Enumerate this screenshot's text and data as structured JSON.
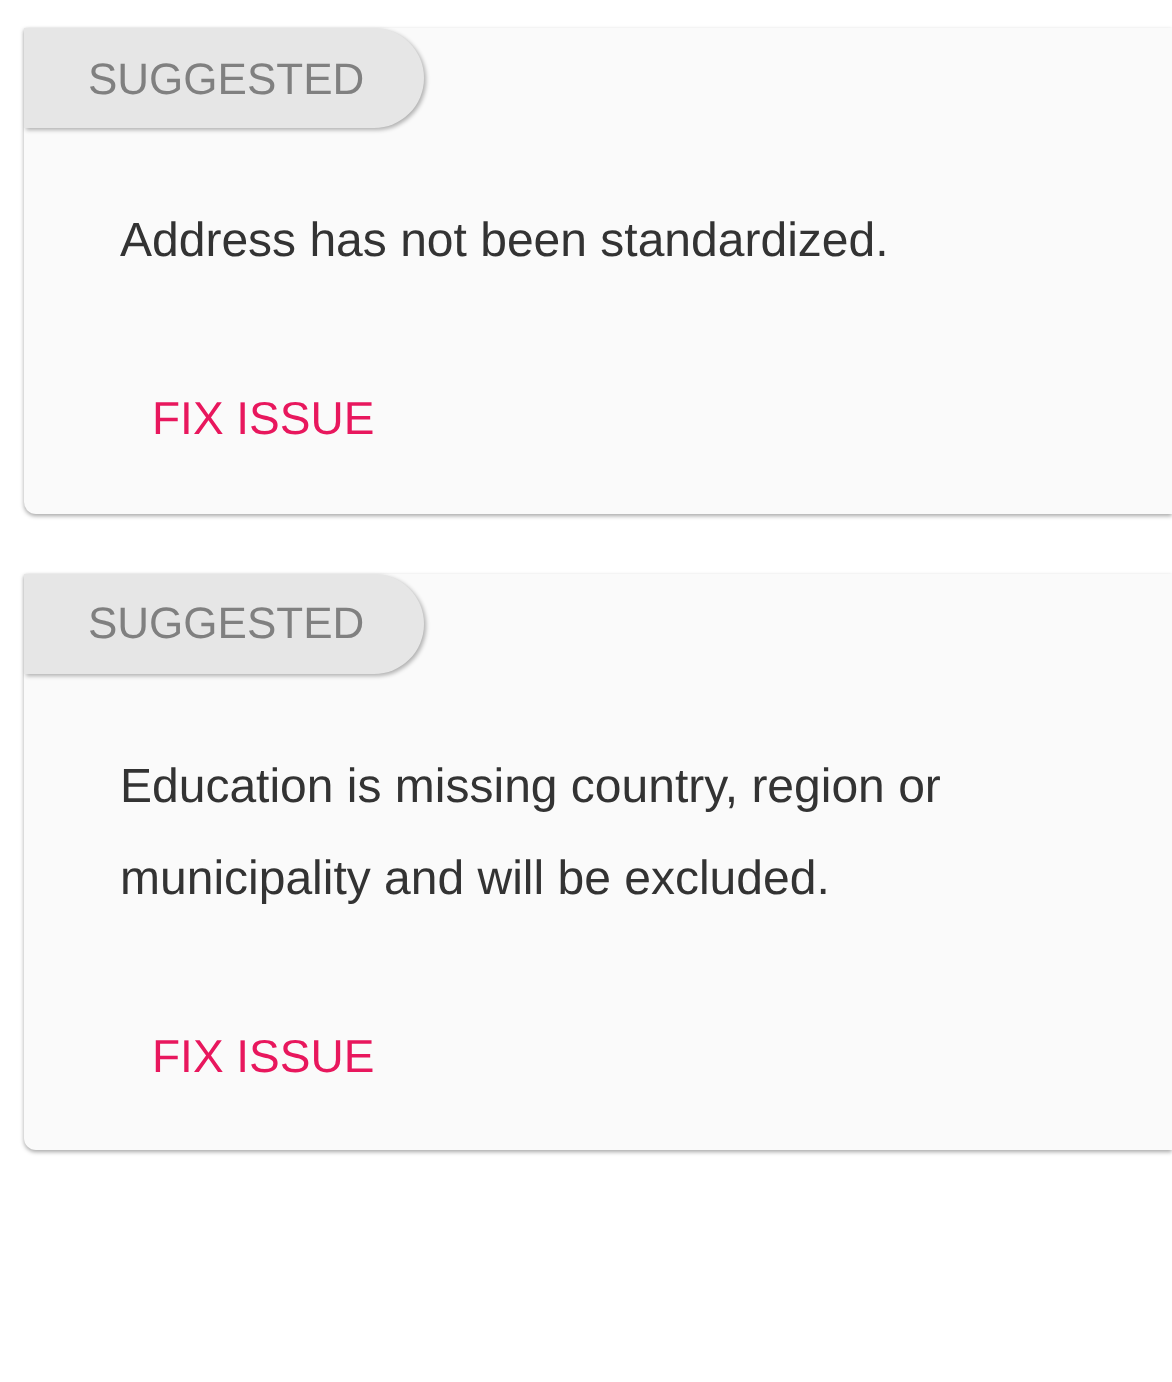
{
  "cards": [
    {
      "badge": "SUGGESTED",
      "message": "Address has not been standardized.",
      "action": "FIX ISSUE"
    },
    {
      "badge": "SUGGESTED",
      "message": "Education is missing country, region or municipality and will be excluded.",
      "action": "FIX ISSUE"
    }
  ]
}
